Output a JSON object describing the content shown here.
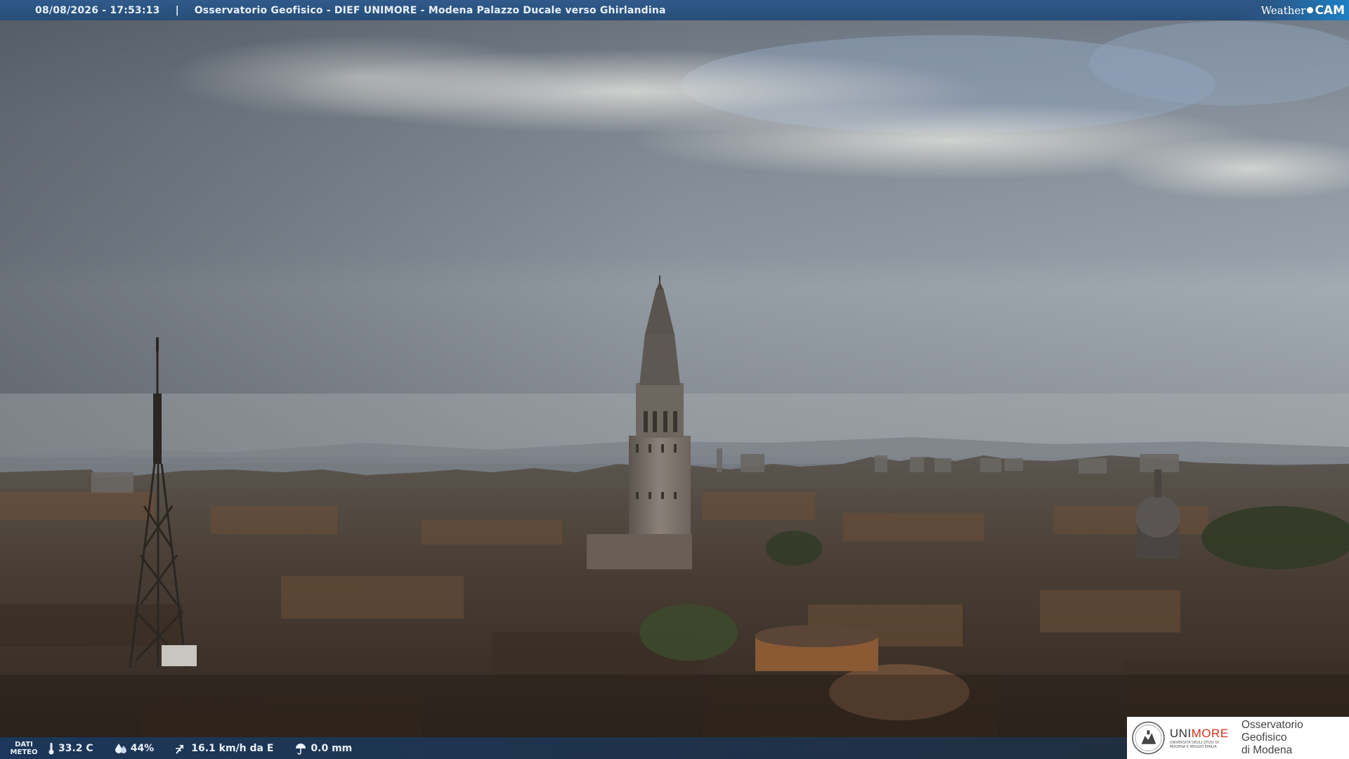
{
  "overlay": {
    "timestamp": "08/08/2026 - 17:53:13",
    "separator": "|",
    "title": "Osservatorio Geofisico - DIEF UNIMORE - Modena Palazzo Ducale verso Ghirlandina",
    "brand": {
      "weather": "Weather",
      "cam": "CAM"
    }
  },
  "meteo": {
    "label_line1": "DATI",
    "label_line2": "METEO",
    "temperature": "33.2 C",
    "humidity": "44%",
    "wind": "16.1 km/h da E",
    "rain": "0.0 mm"
  },
  "logo": {
    "uni_a": "UNI",
    "uni_b": "MORE",
    "uni_sub": "UNIVERSITÀ DEGLI STUDI DI MODENA E REGGIO EMILIA",
    "obs_line1": "Osservatorio Geofisico",
    "obs_line2": "di Modena"
  },
  "colors": {
    "bar": "#2a5685",
    "brand_accent": "#1e7fc3",
    "unimore_red": "#d1341a"
  }
}
